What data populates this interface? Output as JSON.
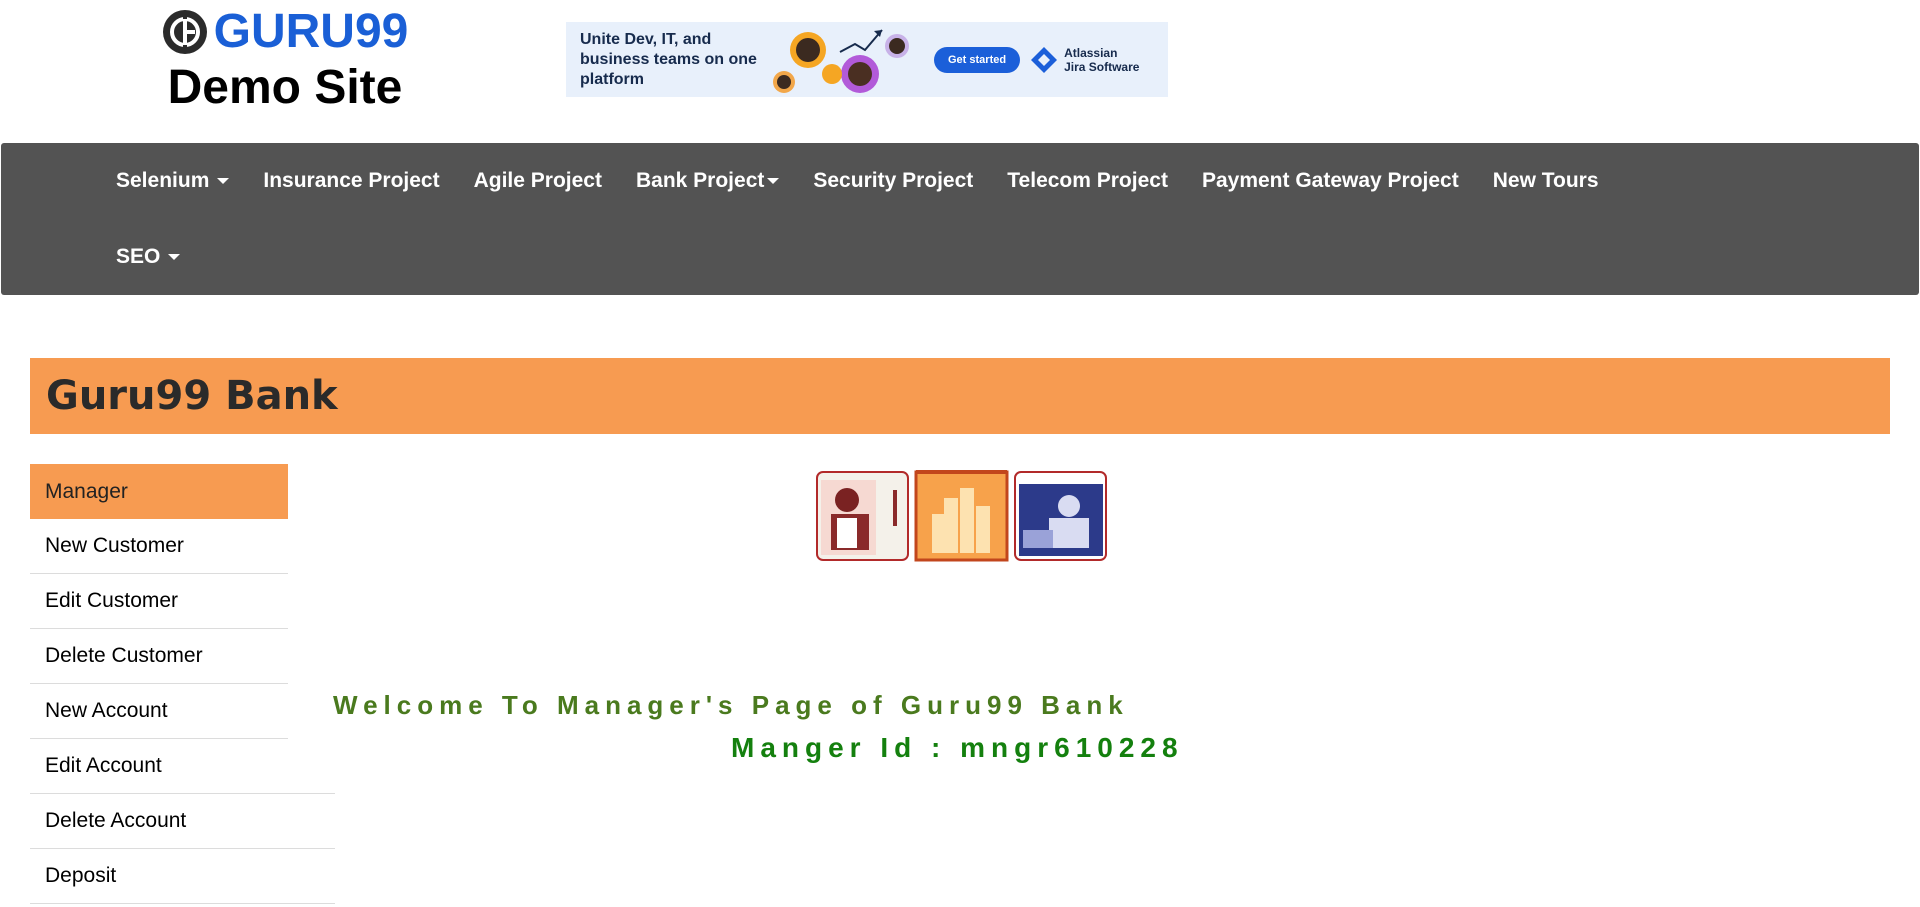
{
  "header": {
    "logo_text": "GURU99",
    "site_title": "Demo Site"
  },
  "ad": {
    "text": "Unite Dev, IT, and business teams on one platform",
    "button_label": "Get started",
    "brand_line1": "Atlassian",
    "brand_line2": "Jira Software"
  },
  "nav": {
    "items": [
      {
        "label": "Selenium",
        "dropdown": true
      },
      {
        "label": "Insurance Project",
        "dropdown": false
      },
      {
        "label": "Agile Project",
        "dropdown": false
      },
      {
        "label": "Bank Project",
        "dropdown": true
      },
      {
        "label": "Security Project",
        "dropdown": false
      },
      {
        "label": "Telecom Project",
        "dropdown": false
      },
      {
        "label": "Payment Gateway Project",
        "dropdown": false
      },
      {
        "label": "New Tours",
        "dropdown": false
      },
      {
        "label": "SEO",
        "dropdown": true
      }
    ]
  },
  "bank": {
    "title": "Guru99 Bank"
  },
  "sidebar": {
    "items": [
      {
        "label": "Manager",
        "active": true
      },
      {
        "label": "New Customer"
      },
      {
        "label": "Edit Customer"
      },
      {
        "label": "Delete Customer"
      },
      {
        "label": "New Account"
      },
      {
        "label": "Edit Account"
      },
      {
        "label": "Delete Account"
      },
      {
        "label": "Deposit"
      }
    ]
  },
  "main": {
    "welcome": "Welcome To Manager's Page of Guru99 Bank",
    "manager_id": "Manger Id : mngr610228"
  },
  "colors": {
    "navbar_bg": "#535353",
    "accent_orange": "#f79b51",
    "welcome_green": "#4a7a1e",
    "id_green": "#14800e",
    "logo_blue": "#1a5fd6"
  }
}
